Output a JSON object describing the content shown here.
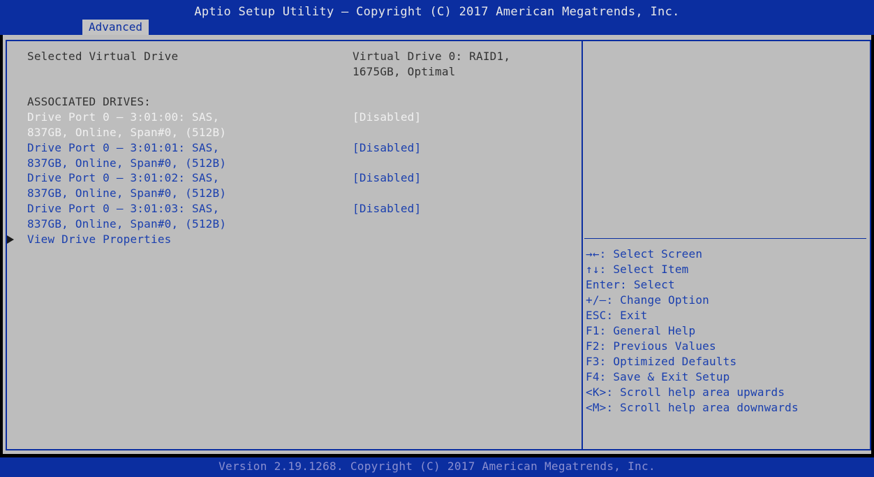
{
  "header": {
    "title": "Aptio Setup Utility – Copyright (C) 2017 American Megatrends, Inc.",
    "tab": "Advanced"
  },
  "main": {
    "selected_label": "Selected Virtual Drive",
    "selected_value_line1": "Virtual Drive 0: RAID1,",
    "selected_value_line2": "1675GB, Optimal",
    "associated_heading": "ASSOCIATED DRIVES:",
    "drives": [
      {
        "line1": "Drive Port 0 – 3:01:00: SAS,",
        "line2": "837GB, Online, Span#0, (512B)",
        "value": "[Disabled]"
      },
      {
        "line1": "Drive Port 0 – 3:01:01: SAS,",
        "line2": "837GB, Online, Span#0, (512B)",
        "value": "[Disabled]"
      },
      {
        "line1": "Drive Port 0 – 3:01:02: SAS,",
        "line2": "837GB, Online, Span#0, (512B)",
        "value": "[Disabled]"
      },
      {
        "line1": "Drive Port 0 – 3:01:03: SAS,",
        "line2": "837GB, Online, Span#0, (512B)",
        "value": "[Disabled]"
      }
    ],
    "submenu": "View Drive Properties"
  },
  "help": [
    "→←: Select Screen",
    "↑↓: Select Item",
    "Enter: Select",
    "+/–: Change Option",
    "ESC: Exit",
    "F1: General Help",
    "F2: Previous Values",
    "F3: Optimized Defaults",
    "F4: Save & Exit Setup",
    "<K>: Scroll help area upwards",
    "<M>: Scroll help area downwards"
  ],
  "footer": {
    "version": "Version 2.19.1268. Copyright (C) 2017 American Megatrends, Inc."
  }
}
